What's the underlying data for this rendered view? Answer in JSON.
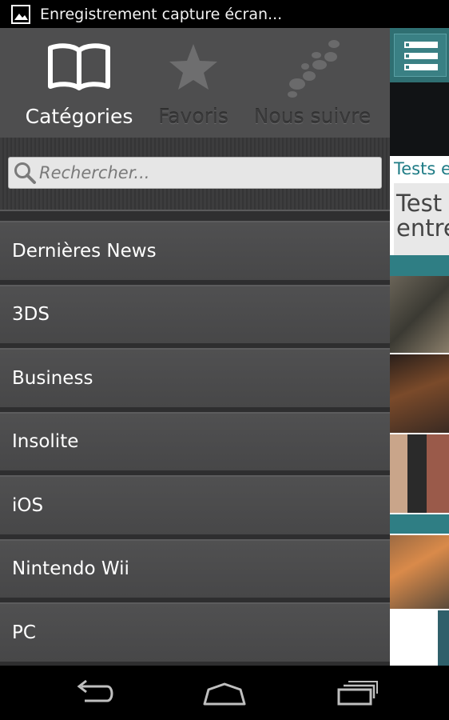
{
  "status_bar": {
    "notification_icon": "image-icon",
    "text": "Enregistrement capture écran..."
  },
  "drawer": {
    "tabs": [
      {
        "label": "Catégories",
        "icon": "book-icon",
        "active": true
      },
      {
        "label": "Favoris",
        "icon": "star-icon",
        "active": false
      },
      {
        "label": "Nous suivre",
        "icon": "footprints-icon",
        "active": false
      }
    ],
    "search": {
      "placeholder": "Rechercher...",
      "value": ""
    },
    "categories": [
      {
        "label": "Dernières News"
      },
      {
        "label": "3DS"
      },
      {
        "label": "Business"
      },
      {
        "label": "Insolite"
      },
      {
        "label": "iOS"
      },
      {
        "label": "Nintendo Wii"
      },
      {
        "label": "PC"
      }
    ]
  },
  "main_peek": {
    "menu_icon": "menu-list-icon",
    "section_label": "Tests e",
    "card_title": "Test\nentre"
  },
  "nav_bar": {
    "back_icon": "back-icon",
    "home_icon": "home-icon",
    "recent_icon": "recent-apps-icon"
  },
  "colors": {
    "drawer_bg": "#4a4a4b",
    "accent_teal": "#2f7e84",
    "section_text": "#1f7c86"
  }
}
